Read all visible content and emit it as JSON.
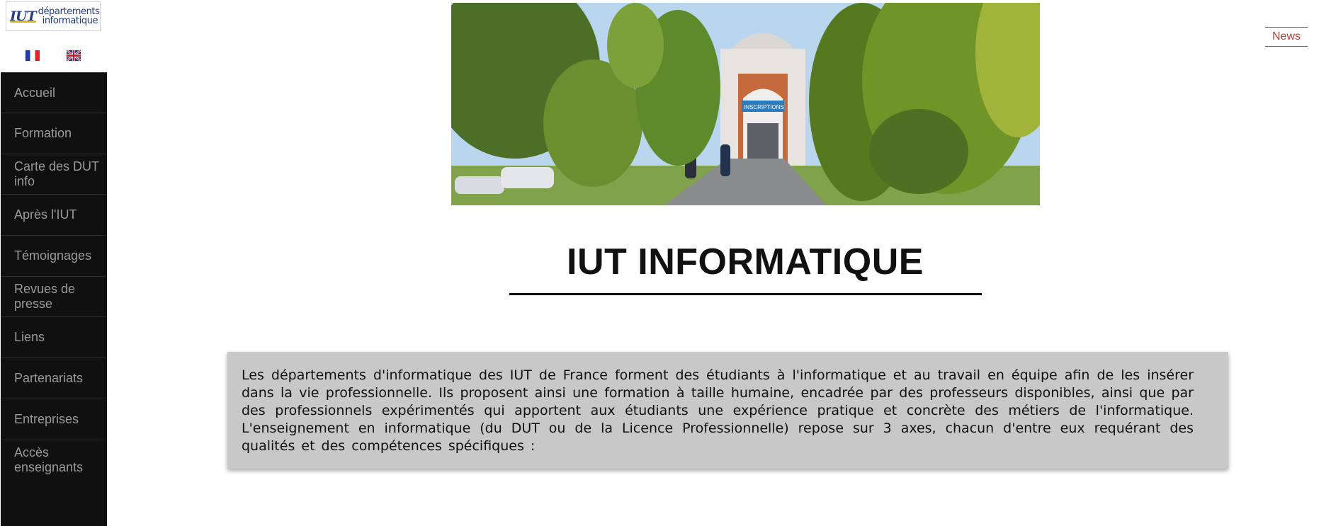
{
  "logo": {
    "mark": "IUT",
    "line1": "départements",
    "line2": "informatique"
  },
  "languages": [
    {
      "name": "french-flag-icon"
    },
    {
      "name": "uk-flag-icon"
    }
  ],
  "nav": {
    "items": [
      {
        "label": "Accueil",
        "height": 57
      },
      {
        "label": "Formation",
        "height": 58
      },
      {
        "label": "Carte des DUT info",
        "height": 137
      },
      {
        "label": "Après l'IUT",
        "height": 58
      },
      {
        "label": "Témoignages",
        "height": 58
      },
      {
        "label": "Revues de presse",
        "height": 137
      },
      {
        "label": "Liens",
        "height": 58
      },
      {
        "label": "Partenariats",
        "height": 58
      },
      {
        "label": "Entreprises",
        "height": 58
      },
      {
        "label": "Accès enseignants",
        "height": 137
      }
    ]
  },
  "news": {
    "label": "News"
  },
  "page": {
    "title": "IUT INFORMATIQUE"
  },
  "intro": {
    "text": "Les départements d'informatique des IUT de France forment des étudiants à l'informatique et au travail en équipe afin de les insérer dans la vie professionnelle. Ils proposent ainsi une formation à taille humaine, encadrée par des professeurs disponibles, ainsi que par des professionnels expérimentés qui apportent aux étudiants une expérience pratique et concrète des métiers de l'informatique. L'enseignement en informatique (du DUT ou de la Licence Professionnelle) repose sur 3 axes, chacun d'entre eux requérant des qualités et des compétences spécifiques :"
  },
  "hero": {
    "sign_text": "INSCRIPTIONS"
  },
  "colors": {
    "nav_bg": "#101010",
    "nav_text": "#9a9a9a",
    "news": "#c0392b",
    "intro_bg": "#c8c8c8"
  }
}
